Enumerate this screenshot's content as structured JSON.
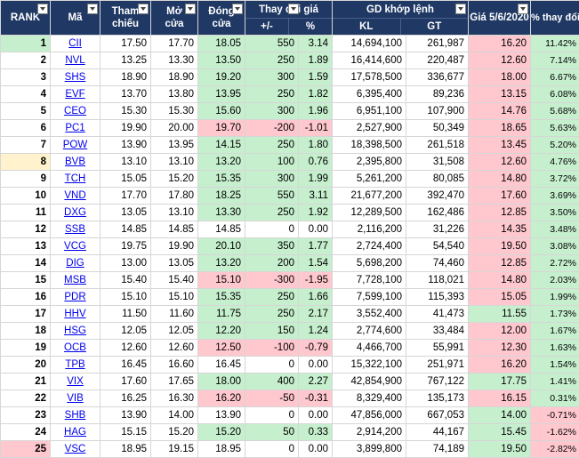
{
  "headers": {
    "rank": "RANK",
    "code": "Mã",
    "ref_line1": "Tham",
    "ref_line2": "chiếu",
    "open_line1": "Mở",
    "open_line2": "cửa",
    "close_line1": "Đóng",
    "close_line2": "cửa",
    "change_group": "Thay đổi giá",
    "change_abs": "+/-",
    "change_pct": "%",
    "match_group": "GD khớp lệnh",
    "kl": "KL",
    "gt": "GT",
    "price_date": "Giá 5/6/2020",
    "pct_change": "% thay đổi"
  },
  "colors": {
    "header_bg": "#1f3864",
    "green_fill": "#c6efce",
    "red_fill": "#ffc7ce",
    "yellow_fill": "#fff2cc",
    "link": "#0000ee"
  },
  "rows": [
    {
      "rank": "1",
      "code": "CII",
      "ref": "17.50",
      "open": "17.70",
      "close": "18.05",
      "chg": "550",
      "chgp": "3.14",
      "kl": "14,694,100",
      "gt": "261,987",
      "price": "16.20",
      "pct": "11.42%",
      "rank_color": "g",
      "close_color": "g",
      "chg_color": "g",
      "price_color": "r",
      "pct_color": "g"
    },
    {
      "rank": "2",
      "code": "NVL",
      "ref": "13.25",
      "open": "13.30",
      "close": "13.50",
      "chg": "250",
      "chgp": "1.89",
      "kl": "16,414,600",
      "gt": "220,487",
      "price": "12.60",
      "pct": "7.14%",
      "rank_color": "",
      "close_color": "g",
      "chg_color": "g",
      "price_color": "r",
      "pct_color": "g"
    },
    {
      "rank": "3",
      "code": "SHS",
      "ref": "18.90",
      "open": "18.90",
      "close": "19.20",
      "chg": "300",
      "chgp": "1.59",
      "kl": "17,578,500",
      "gt": "336,677",
      "price": "18.00",
      "pct": "6.67%",
      "rank_color": "",
      "close_color": "g",
      "chg_color": "g",
      "price_color": "r",
      "pct_color": "g"
    },
    {
      "rank": "4",
      "code": "EVF",
      "ref": "13.70",
      "open": "13.80",
      "close": "13.95",
      "chg": "250",
      "chgp": "1.82",
      "kl": "6,395,400",
      "gt": "89,236",
      "price": "13.15",
      "pct": "6.08%",
      "rank_color": "",
      "close_color": "g",
      "chg_color": "g",
      "price_color": "r",
      "pct_color": "g"
    },
    {
      "rank": "5",
      "code": "CEO",
      "ref": "15.30",
      "open": "15.30",
      "close": "15.60",
      "chg": "300",
      "chgp": "1.96",
      "kl": "6,951,100",
      "gt": "107,900",
      "price": "14.76",
      "pct": "5.68%",
      "rank_color": "",
      "close_color": "g",
      "chg_color": "g",
      "price_color": "r",
      "pct_color": "g"
    },
    {
      "rank": "6",
      "code": "PC1",
      "ref": "19.90",
      "open": "20.00",
      "close": "19.70",
      "chg": "-200",
      "chgp": "-1.01",
      "kl": "2,527,900",
      "gt": "50,349",
      "price": "18.65",
      "pct": "5.63%",
      "rank_color": "",
      "close_color": "r",
      "chg_color": "r",
      "price_color": "r",
      "pct_color": "g"
    },
    {
      "rank": "7",
      "code": "POW",
      "ref": "13.90",
      "open": "13.95",
      "close": "14.15",
      "chg": "250",
      "chgp": "1.80",
      "kl": "18,398,500",
      "gt": "261,518",
      "price": "13.45",
      "pct": "5.20%",
      "rank_color": "",
      "close_color": "g",
      "chg_color": "g",
      "price_color": "r",
      "pct_color": "g"
    },
    {
      "rank": "8",
      "code": "BVB",
      "ref": "13.10",
      "open": "13.10",
      "close": "13.20",
      "chg": "100",
      "chgp": "0.76",
      "kl": "2,395,800",
      "gt": "31,508",
      "price": "12.60",
      "pct": "4.76%",
      "rank_color": "y",
      "close_color": "g",
      "chg_color": "g",
      "price_color": "r",
      "pct_color": "g"
    },
    {
      "rank": "9",
      "code": "TCH",
      "ref": "15.05",
      "open": "15.20",
      "close": "15.35",
      "chg": "300",
      "chgp": "1.99",
      "kl": "5,261,200",
      "gt": "80,085",
      "price": "14.80",
      "pct": "3.72%",
      "rank_color": "",
      "close_color": "g",
      "chg_color": "g",
      "price_color": "r",
      "pct_color": "g"
    },
    {
      "rank": "10",
      "code": "VND",
      "ref": "17.70",
      "open": "17.80",
      "close": "18.25",
      "chg": "550",
      "chgp": "3.11",
      "kl": "21,677,200",
      "gt": "392,470",
      "price": "17.60",
      "pct": "3.69%",
      "rank_color": "",
      "close_color": "g",
      "chg_color": "g",
      "price_color": "r",
      "pct_color": "g"
    },
    {
      "rank": "11",
      "code": "DXG",
      "ref": "13.05",
      "open": "13.10",
      "close": "13.30",
      "chg": "250",
      "chgp": "1.92",
      "kl": "12,289,500",
      "gt": "162,486",
      "price": "12.85",
      "pct": "3.50%",
      "rank_color": "",
      "close_color": "g",
      "chg_color": "g",
      "price_color": "r",
      "pct_color": "g"
    },
    {
      "rank": "12",
      "code": "SSB",
      "ref": "14.85",
      "open": "14.85",
      "close": "14.85",
      "chg": "0",
      "chgp": "0.00",
      "kl": "2,116,200",
      "gt": "31,226",
      "price": "14.35",
      "pct": "3.48%",
      "rank_color": "",
      "close_color": "",
      "chg_color": "",
      "price_color": "r",
      "pct_color": "g"
    },
    {
      "rank": "13",
      "code": "VCG",
      "ref": "19.75",
      "open": "19.90",
      "close": "20.10",
      "chg": "350",
      "chgp": "1.77",
      "kl": "2,724,400",
      "gt": "54,540",
      "price": "19.50",
      "pct": "3.08%",
      "rank_color": "",
      "close_color": "g",
      "chg_color": "g",
      "price_color": "r",
      "pct_color": "g"
    },
    {
      "rank": "14",
      "code": "DIG",
      "ref": "13.00",
      "open": "13.05",
      "close": "13.20",
      "chg": "200",
      "chgp": "1.54",
      "kl": "5,698,200",
      "gt": "74,460",
      "price": "12.85",
      "pct": "2.72%",
      "rank_color": "",
      "close_color": "g",
      "chg_color": "g",
      "price_color": "r",
      "pct_color": "g"
    },
    {
      "rank": "15",
      "code": "MSB",
      "ref": "15.40",
      "open": "15.40",
      "close": "15.10",
      "chg": "-300",
      "chgp": "-1.95",
      "kl": "7,728,100",
      "gt": "118,021",
      "price": "14.80",
      "pct": "2.03%",
      "rank_color": "",
      "close_color": "r",
      "chg_color": "r",
      "price_color": "r",
      "pct_color": "g"
    },
    {
      "rank": "16",
      "code": "PDR",
      "ref": "15.10",
      "open": "15.10",
      "close": "15.35",
      "chg": "250",
      "chgp": "1.66",
      "kl": "7,599,100",
      "gt": "115,393",
      "price": "15.05",
      "pct": "1.99%",
      "rank_color": "",
      "close_color": "g",
      "chg_color": "g",
      "price_color": "r",
      "pct_color": "g"
    },
    {
      "rank": "17",
      "code": "HHV",
      "ref": "11.50",
      "open": "11.60",
      "close": "11.75",
      "chg": "250",
      "chgp": "2.17",
      "kl": "3,552,400",
      "gt": "41,473",
      "price": "11.55",
      "pct": "1.73%",
      "rank_color": "",
      "close_color": "g",
      "chg_color": "g",
      "price_color": "g",
      "pct_color": "g"
    },
    {
      "rank": "18",
      "code": "HSG",
      "ref": "12.05",
      "open": "12.05",
      "close": "12.20",
      "chg": "150",
      "chgp": "1.24",
      "kl": "2,774,600",
      "gt": "33,484",
      "price": "12.00",
      "pct": "1.67%",
      "rank_color": "",
      "close_color": "g",
      "chg_color": "g",
      "price_color": "r",
      "pct_color": "g"
    },
    {
      "rank": "19",
      "code": "OCB",
      "ref": "12.60",
      "open": "12.60",
      "close": "12.50",
      "chg": "-100",
      "chgp": "-0.79",
      "kl": "4,466,700",
      "gt": "55,991",
      "price": "12.30",
      "pct": "1.63%",
      "rank_color": "",
      "close_color": "r",
      "chg_color": "r",
      "price_color": "r",
      "pct_color": "g"
    },
    {
      "rank": "20",
      "code": "TPB",
      "ref": "16.45",
      "open": "16.60",
      "close": "16.45",
      "chg": "0",
      "chgp": "0.00",
      "kl": "15,322,100",
      "gt": "251,971",
      "price": "16.20",
      "pct": "1.54%",
      "rank_color": "",
      "close_color": "",
      "chg_color": "",
      "price_color": "r",
      "pct_color": "g"
    },
    {
      "rank": "21",
      "code": "VIX",
      "ref": "17.60",
      "open": "17.65",
      "close": "18.00",
      "chg": "400",
      "chgp": "2.27",
      "kl": "42,854,900",
      "gt": "767,122",
      "price": "17.75",
      "pct": "1.41%",
      "rank_color": "",
      "close_color": "g",
      "chg_color": "g",
      "price_color": "g",
      "pct_color": "g"
    },
    {
      "rank": "22",
      "code": "VIB",
      "ref": "16.25",
      "open": "16.30",
      "close": "16.20",
      "chg": "-50",
      "chgp": "-0.31",
      "kl": "8,329,400",
      "gt": "135,173",
      "price": "16.15",
      "pct": "0.31%",
      "rank_color": "",
      "close_color": "r",
      "chg_color": "r",
      "price_color": "r",
      "pct_color": "g"
    },
    {
      "rank": "23",
      "code": "SHB",
      "ref": "13.90",
      "open": "14.00",
      "close": "13.90",
      "chg": "0",
      "chgp": "0.00",
      "kl": "47,856,000",
      "gt": "667,053",
      "price": "14.00",
      "pct": "-0.71%",
      "rank_color": "",
      "close_color": "",
      "chg_color": "",
      "price_color": "g",
      "pct_color": "r"
    },
    {
      "rank": "24",
      "code": "HAG",
      "ref": "15.15",
      "open": "15.20",
      "close": "15.20",
      "chg": "50",
      "chgp": "0.33",
      "kl": "2,914,200",
      "gt": "44,167",
      "price": "15.45",
      "pct": "-1.62%",
      "rank_color": "",
      "close_color": "g",
      "chg_color": "g",
      "price_color": "g",
      "pct_color": "r"
    },
    {
      "rank": "25",
      "code": "VSC",
      "ref": "18.95",
      "open": "19.15",
      "close": "18.95",
      "chg": "0",
      "chgp": "0.00",
      "kl": "3,899,800",
      "gt": "74,189",
      "price": "19.50",
      "pct": "-2.82%",
      "rank_color": "r",
      "close_color": "",
      "chg_color": "",
      "price_color": "g",
      "pct_color": "r"
    }
  ]
}
